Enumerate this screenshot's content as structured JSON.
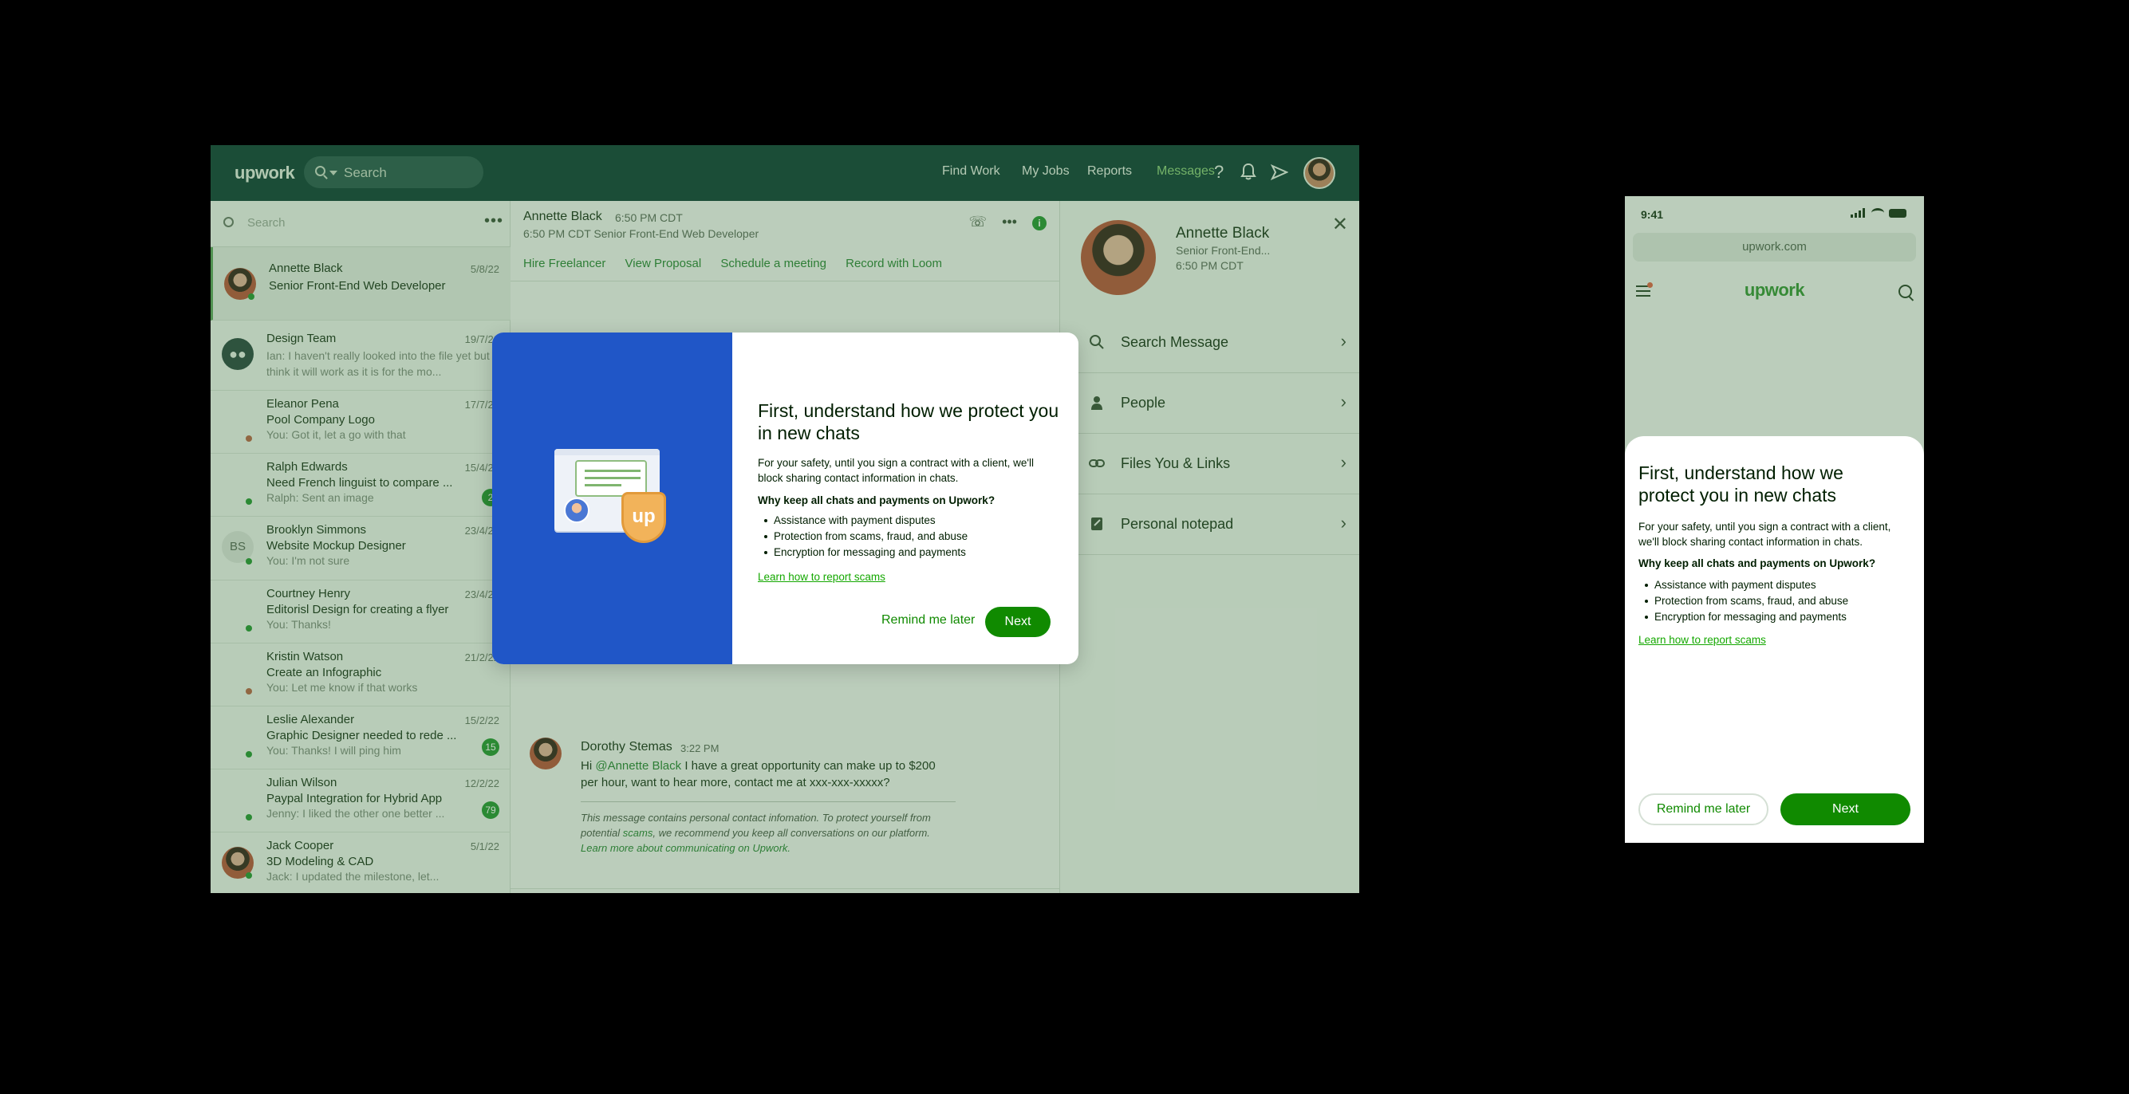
{
  "desktop": {
    "logo": "upwork",
    "search_placeholder": "Search",
    "nav": [
      "Find Work",
      "My Jobs",
      "Reports",
      "Messages"
    ],
    "nav_active": "Messages",
    "icons": [
      "help-icon",
      "bell-icon",
      "send-icon"
    ],
    "left": {
      "search_placeholder": "Search",
      "conversations": [
        {
          "name": "Annette Black",
          "date": "5/8/22",
          "subject": "Senior Front-End Web Developer",
          "preview": "",
          "avatar": "photo",
          "status": "online",
          "badge": ""
        },
        {
          "name": "Design Team",
          "date": "19/7/22",
          "subject": "",
          "preview": "Ian: I haven't really looked into the file yet but I think it will work as it is for the mo...",
          "avatar": "team",
          "status": "",
          "badge": ""
        },
        {
          "name": "Eleanor Pena",
          "date": "17/7/22",
          "subject": "Pool Company Logo",
          "preview": "You: Got it, let a go with that",
          "avatar": "none",
          "status": "away",
          "badge": ""
        },
        {
          "name": "Ralph Edwards",
          "date": "15/4/22",
          "subject": "Need French linguist to compare ...",
          "preview": "Ralph: Sent an image",
          "avatar": "none",
          "status": "online",
          "badge": "2"
        },
        {
          "name": "Brooklyn Simmons",
          "date": "23/4/22",
          "subject": "Website Mockup Designer",
          "preview": "You: I'm not sure",
          "avatar": "initials",
          "initials": "BS",
          "status": "online",
          "badge": ""
        },
        {
          "name": "Courtney Henry",
          "date": "23/4/22",
          "subject": "Editorisl Design for creating a flyer",
          "preview": "You: Thanks!",
          "avatar": "none",
          "status": "online",
          "badge": ""
        },
        {
          "name": "Kristin Watson",
          "date": "21/2/22",
          "subject": "Create an Infographic",
          "preview": "You: Let me know if that works",
          "avatar": "none",
          "status": "away",
          "badge": ""
        },
        {
          "name": "Leslie Alexander",
          "date": "15/2/22",
          "subject": "Graphic Designer needed to rede ...",
          "preview": "You: Thanks! I will ping him",
          "avatar": "none",
          "status": "online",
          "badge": "15"
        },
        {
          "name": "Julian Wilson",
          "date": "12/2/22",
          "subject": "Paypal Integration for Hybrid App",
          "preview": "Jenny: I liked the other one better ...",
          "avatar": "none",
          "status": "online",
          "badge": "79"
        },
        {
          "name": "Jack Cooper",
          "date": "5/1/22",
          "subject": "3D Modeling & CAD",
          "preview": "Jack: I updated the milestone, let...",
          "avatar": "photo",
          "status": "online",
          "badge": ""
        }
      ]
    },
    "chat": {
      "title": "Annette Black",
      "time": "6:50 PM CDT",
      "subtitle": "6:50 PM CDT Senior Front-End Web Developer",
      "actions": [
        "Hire Freelancer",
        "View Proposal",
        "Schedule a meeting",
        "Record with Loom"
      ],
      "message": {
        "sender": "Dorothy Stemas",
        "time": "3:22 PM",
        "greeting": "Hi",
        "mention": "@Annette Black",
        "text": "I have a great opportunity can make up to $200 per hour, want to hear more, contact me at xxx-xxx-xxxxx?",
        "warning_pre": "This message contains personal contact infomation. To protect yourself from potential",
        "warning_link": "scams",
        "warning_post": ", we recommend you keep all conversations on our platform.",
        "warning_learn": "Learn more about communicating on Upwork."
      }
    },
    "profile": {
      "name": "Annette Black",
      "role": "Senior Front-End...",
      "time": "6:50 PM CDT",
      "items": [
        "Search Message",
        "People",
        "Files You & Links",
        "Personal notepad"
      ]
    },
    "modal": {
      "title": "First, understand how we protect you in new chats",
      "description": "For your safety, until you sign a contract with a client, we'll block sharing contact information in chats.",
      "why_heading": "Why keep all chats and payments on Upwork?",
      "bullets": [
        "Assistance with payment disputes",
        "Protection from scams, fraud, and abuse",
        "Encryption for messaging and payments"
      ],
      "link": "Learn how to report scams",
      "remind": "Remind me later",
      "next": "Next",
      "badge_text": "up"
    }
  },
  "mobile": {
    "status_time": "9:41",
    "url": "upwork.com",
    "logo": "upwork",
    "sheet": {
      "title": "First, understand how we protect you in new chats",
      "description": "For your safety, until you sign a contract with a client, we'll block sharing contact information in chats.",
      "why_heading": "Why keep all chats and payments on Upwork?",
      "bullets": [
        "Assistance with payment disputes",
        "Protection from scams, fraud, and abuse",
        "Encryption for messaging and payments"
      ],
      "link": "Learn how to report scams",
      "remind": "Remind me later",
      "next": "Next"
    }
  },
  "colors": {
    "brand_green": "#108a00",
    "nav_bg": "#14463b",
    "modal_illustration_bg": "#2056c7",
    "online": "#2a9a36",
    "away": "#b86a4a"
  }
}
